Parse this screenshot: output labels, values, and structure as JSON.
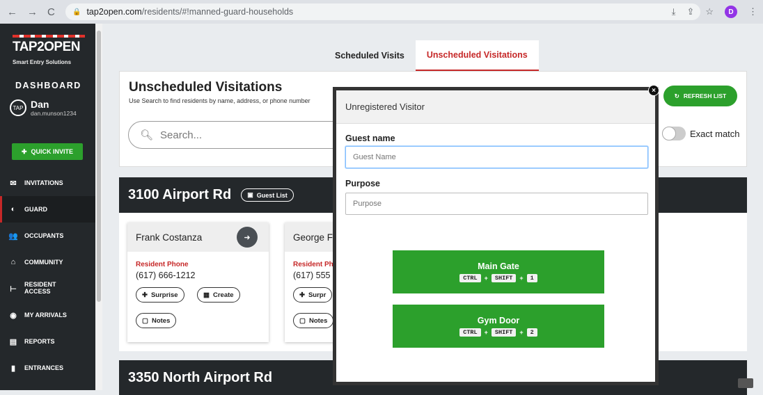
{
  "browser": {
    "url_domain": "tap2open.com",
    "url_path": "/residents/#!manned-guard-households",
    "profile_initial": "D"
  },
  "sidebar": {
    "brand": "TAP2OPEN",
    "tagline": "Smart Entry Solutions",
    "dashboard": "DASHBOARD",
    "user_name": "Dan",
    "user_handle": "dan.munson1234",
    "avatar_text": "TAP",
    "quick_invite": "QUICK INVITE",
    "items": [
      {
        "label": "INVITATIONS",
        "icon": "envelope-icon"
      },
      {
        "label": "GUARD",
        "icon": "shield-icon"
      },
      {
        "label": "OCCUPANTS",
        "icon": "people-icon"
      },
      {
        "label": "COMMUNITY",
        "icon": "home-icon"
      },
      {
        "label": "RESIDENT ACCESS",
        "icon": "gate-icon"
      },
      {
        "label": "MY ARRIVALS",
        "icon": "eye-icon"
      },
      {
        "label": "REPORTS",
        "icon": "report-icon"
      },
      {
        "label": "ENTRANCES",
        "icon": "door-icon"
      }
    ]
  },
  "tabs": [
    "Scheduled Visits",
    "Unscheduled Visitations"
  ],
  "panel": {
    "title": "Unscheduled Visitations",
    "hint": "Use Search to find residents by name, address, or phone number",
    "search_placeholder": "Search...",
    "refresh": "REFRESH LIST",
    "exact_match": "Exact match"
  },
  "households": [
    {
      "address": "3100 Airport Rd",
      "guest_list": "Guest List",
      "residents": [
        {
          "name": "Frank Costanza",
          "phone_label": "Resident Phone",
          "phone": "(617) 666-1212",
          "surprise": "Surprise",
          "create": "Create",
          "notes": "Notes"
        },
        {
          "name": "George F",
          "phone_label": "Resident Ph",
          "phone": "(617) 555",
          "surprise": "Surpr",
          "notes": "Notes"
        }
      ]
    },
    {
      "address": "3350 North Airport Rd"
    }
  ],
  "modal": {
    "title": "Unregistered Visitor",
    "guest_label": "Guest name",
    "guest_placeholder": "Guest Name",
    "purpose_label": "Purpose",
    "purpose_placeholder": "Purpose",
    "gates": [
      {
        "name": "Main Gate",
        "keys": [
          "CTRL",
          "SHIFT",
          "1"
        ]
      },
      {
        "name": "Gym Door",
        "keys": [
          "CTRL",
          "SHIFT",
          "2"
        ]
      }
    ],
    "close": "×"
  },
  "colors": {
    "accent_green": "#2ca02c",
    "accent_red": "#c62828",
    "dark": "#24282b"
  }
}
